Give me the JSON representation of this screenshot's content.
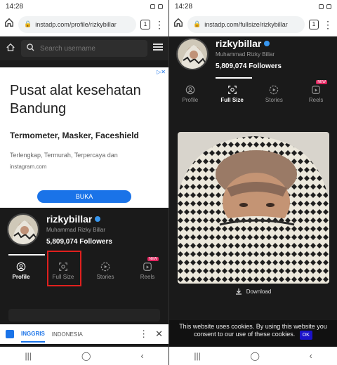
{
  "left": {
    "status_time": "14:28",
    "url": "instadp.com/profile/rizkybillar",
    "tab_count": "1",
    "search_placeholder": "Search username",
    "ad": {
      "badge": "▷✕",
      "headline": "Pusat alat kesehatan Bandung",
      "subhead": "Termometer, Masker, Faceshield",
      "desc": "Terlengkap, Termurah, Terpercaya dan",
      "source": "instagram.com",
      "cta": "BUKA"
    },
    "profile": {
      "username": "rizkybillar",
      "fullname": "Muhammad Rizky Billar",
      "followers": "5,809,074 Followers"
    },
    "tabs": [
      {
        "label": "Profile"
      },
      {
        "label": "Full Size"
      },
      {
        "label": "Stories"
      },
      {
        "label": "Reels",
        "badge": "NEW"
      }
    ],
    "translate": {
      "lang_active": "INGGRIS",
      "lang_other": "INDONESIA"
    }
  },
  "right": {
    "status_time": "14:28",
    "url": "instadp.com/fullsize/rizkybillar",
    "tab_count": "1",
    "profile": {
      "username": "rizkybillar",
      "fullname": "Muhammad Rizky Billar",
      "followers": "5,809,074 Followers"
    },
    "tabs": [
      {
        "label": "Profile"
      },
      {
        "label": "Full Size"
      },
      {
        "label": "Stories"
      },
      {
        "label": "Reels",
        "badge": "NEW"
      }
    ],
    "download_label": "Download",
    "cookie_text": "This website uses cookies. By using this website you consent to our use of these cookies.",
    "cookie_ok": "OK"
  },
  "colors": {
    "accent": "#1a73e8",
    "highlight": "#e0201e",
    "verified": "#3897f0"
  }
}
